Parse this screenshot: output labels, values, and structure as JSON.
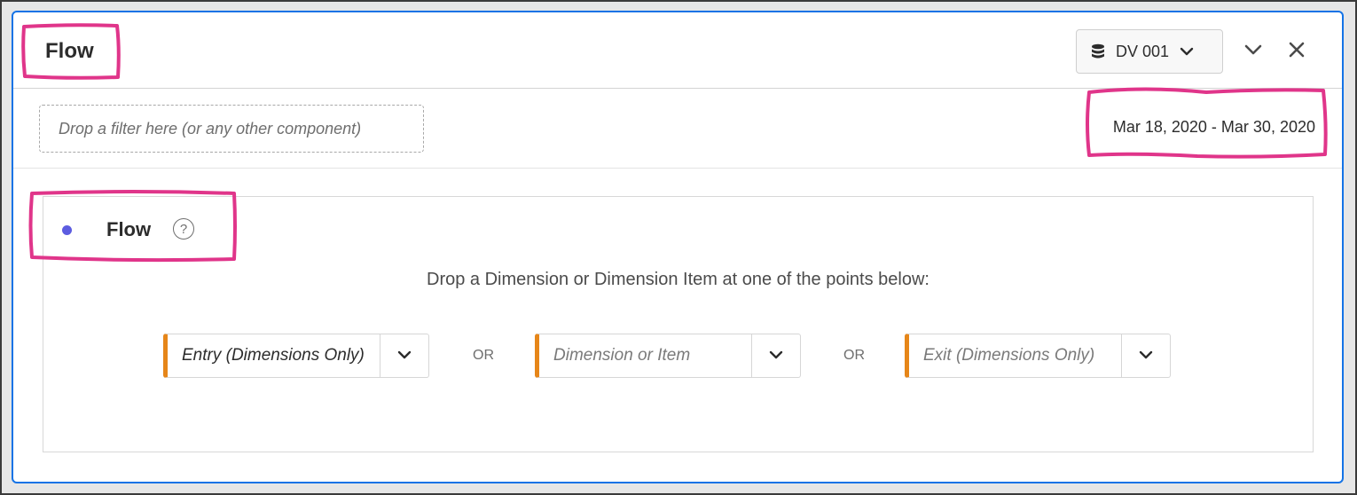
{
  "panel": {
    "title": "Flow",
    "data_view_label": "DV 001",
    "data_view_icon": "database-icon",
    "collapse_icon": "chevron-down-icon",
    "close_icon": "close-icon"
  },
  "filter_bar": {
    "drop_placeholder": "Drop a filter here (or any other component)",
    "date_range": "Mar 18, 2020 - Mar 30, 2020"
  },
  "visualization": {
    "title": "Flow",
    "help_glyph": "?",
    "instruction": "Drop a Dimension or Dimension Item at one of the points below:",
    "slots": [
      {
        "label": "Entry (Dimensions Only)",
        "active": true
      },
      {
        "label": "Dimension or Item",
        "active": false
      },
      {
        "label": "Exit (Dimensions Only)",
        "active": false
      }
    ],
    "separator": "OR"
  },
  "colors": {
    "accent_blue": "#1473e6",
    "slot_orange": "#e68619",
    "dot_purple": "#5c5ce0",
    "annotation_pink": "#e0358a"
  }
}
